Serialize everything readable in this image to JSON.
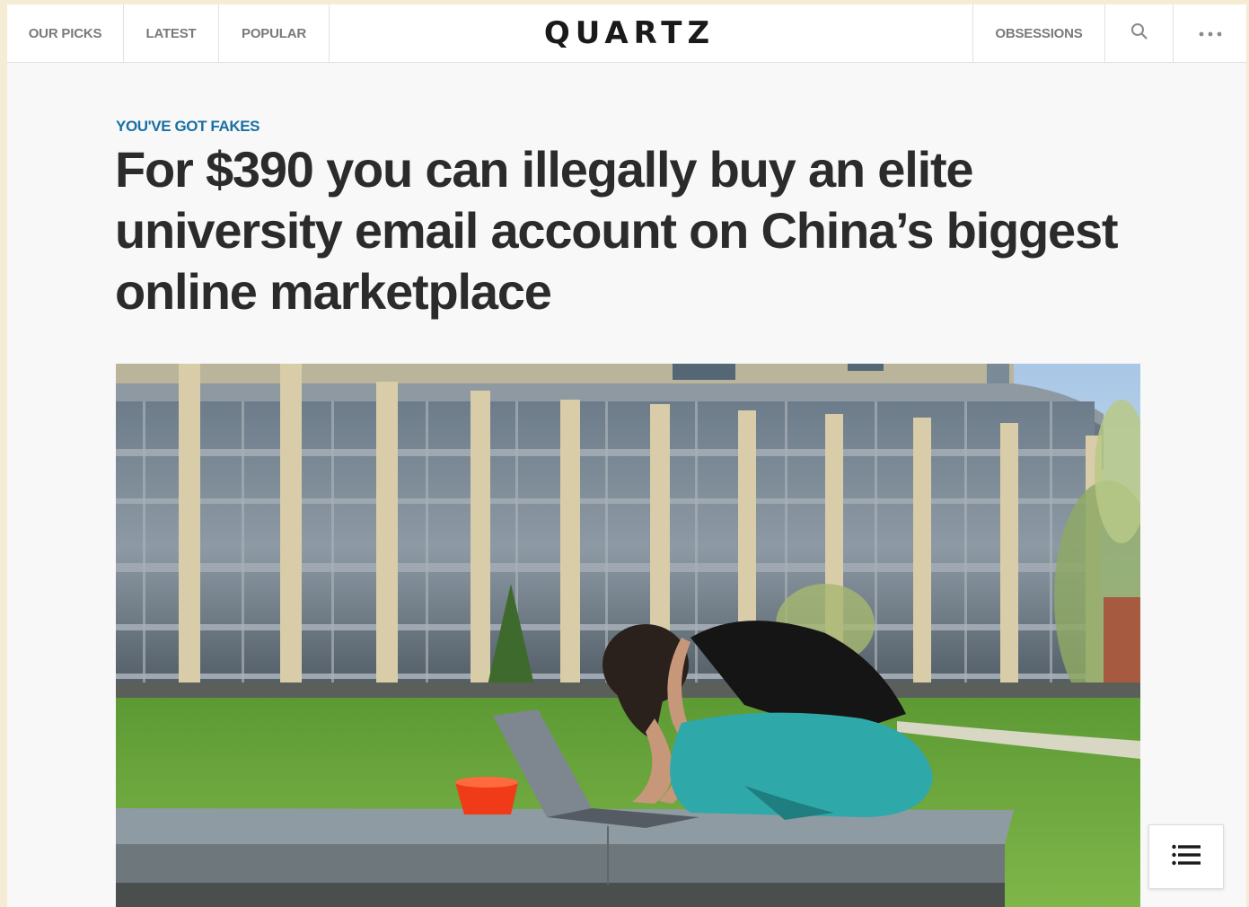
{
  "nav": {
    "left_items": [
      {
        "label": "OUR PICKS"
      },
      {
        "label": "LATEST"
      },
      {
        "label": "POPULAR"
      }
    ],
    "logo": "QUARTZ",
    "right_items": [
      {
        "label": "OBSESSIONS"
      }
    ],
    "search_icon": "search-icon",
    "more_icon": "more-dots-icon"
  },
  "article": {
    "kicker": "YOU'VE GOT FAKES",
    "headline": "For $390 you can illegally buy an elite university email account on China’s biggest online marketplace",
    "hero_image": "student-laptop-campus-lawn-photo"
  },
  "toc_button": {
    "icon": "list-icon"
  },
  "colors": {
    "kicker": "#1a6fa5",
    "headline": "#2b2b2b",
    "nav_text": "#7a7a7a",
    "page_bg": "#f8f8f8"
  }
}
